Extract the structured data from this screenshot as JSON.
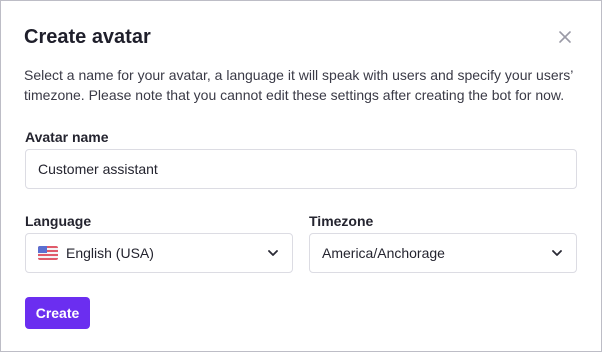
{
  "dialog": {
    "title": "Create avatar",
    "description": "Select a name for your avatar, a language it will speak with users and specify your users’ timezone. Please note that you cannot edit these settings after creating the bot for now.",
    "close_icon": "close-icon"
  },
  "form": {
    "avatar_name": {
      "label": "Avatar name",
      "value": "Customer assistant"
    },
    "language": {
      "label": "Language",
      "value": "English (USA)",
      "flag_icon": "us-flag-icon"
    },
    "timezone": {
      "label": "Timezone",
      "value": "America/Anchorage"
    },
    "create_label": "Create"
  },
  "colors": {
    "primary": "#6b2ef0",
    "border": "#dcdce3",
    "text": "#24242f"
  }
}
